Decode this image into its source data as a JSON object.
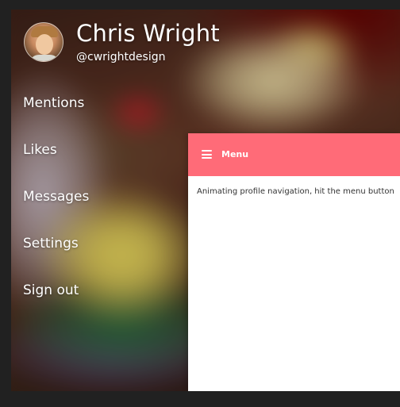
{
  "profile": {
    "name": "Chris Wright",
    "handle": "@cwrightdesign"
  },
  "nav": {
    "items": [
      {
        "label": "Mentions"
      },
      {
        "label": "Likes"
      },
      {
        "label": "Messages"
      },
      {
        "label": "Settings"
      },
      {
        "label": "Sign out"
      }
    ]
  },
  "panel": {
    "menu_label": "Menu",
    "menu_icon": "hamburger-icon",
    "body_text": "Animating profile navigation, hit the menu button"
  },
  "colors": {
    "header_accent": "#ff6b78",
    "page_background": "#212121",
    "panel_background": "#ffffff"
  }
}
